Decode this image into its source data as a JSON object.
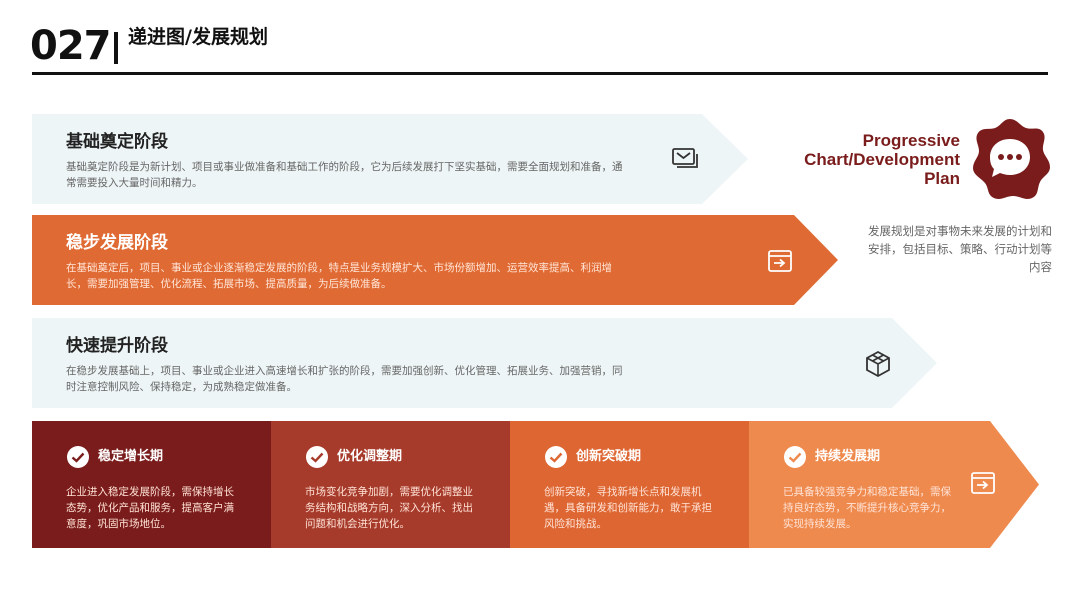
{
  "header": {
    "page_number": "027",
    "title": "递进图/发展规划"
  },
  "stages": [
    {
      "title": "基础奠定阶段",
      "description": "基础奠定阶段是为新计划、项目或事业做准备和基础工作的阶段，它为后续发展打下坚实基础，需要全面规划和准备，通常需要投入大量时间和精力。",
      "icon": "message-stack-icon",
      "fill": "#eef5f6"
    },
    {
      "title": "稳步发展阶段",
      "description": "在基础奠定后，项目、事业或企业逐渐稳定发展的阶段，特点是业务规模扩大、市场份额增加、运营效率提高、利润增长，需要加强管理、优化流程、拓展市场、提高质量，为后续做准备。",
      "icon": "inbox-arrow-icon",
      "fill": "#e06a33"
    },
    {
      "title": "快速提升阶段",
      "description": "在稳步发展基础上，项目、事业或企业进入高速增长和扩张的阶段，需要加强创新、优化管理、拓展业务、加强营销，同时注意控制风险、保持稳定，为成熟稳定做准备。",
      "icon": "cube-outline-icon",
      "fill": "#eef5f6"
    }
  ],
  "phases": [
    {
      "label": "稳定增长期",
      "description": "企业进入稳定发展阶段，需保持增长态势，优化产品和服务，提高客户满意度，巩固市场地位。",
      "fill": "#7a1c1c"
    },
    {
      "label": "优化调整期",
      "description": "市场变化竞争加剧，需要优化调整业务结构和战略方向，深入分析、找出问题和机会进行优化。",
      "fill": "#a63a2b"
    },
    {
      "label": "创新突破期",
      "description": "创新突破，寻找新增长点和发展机遇，具备研发和创新能力，敢于承担风险和挑战。",
      "fill": "#dd6632"
    },
    {
      "label": "持续发展期",
      "description": "已具备较强竞争力和稳定基础，需保持良好态势，不断提升核心竞争力，实现持续发展。",
      "fill": "#ef8a4e",
      "icon": "inbox-arrow-icon"
    }
  ],
  "side": {
    "title_lines": [
      "Progressive",
      "Chart/Development",
      "Plan"
    ],
    "description": "发展规划是对事物未来发展的计划和安排，包括目标、策略、行动计划等内容",
    "badge_icon": "chat-bubble-icon",
    "badge_color": "#7a1c1c"
  },
  "colors": {
    "accent_dark": "#7a1c1c",
    "accent_orange": "#e06a33",
    "light_fill": "#eef5f6"
  }
}
